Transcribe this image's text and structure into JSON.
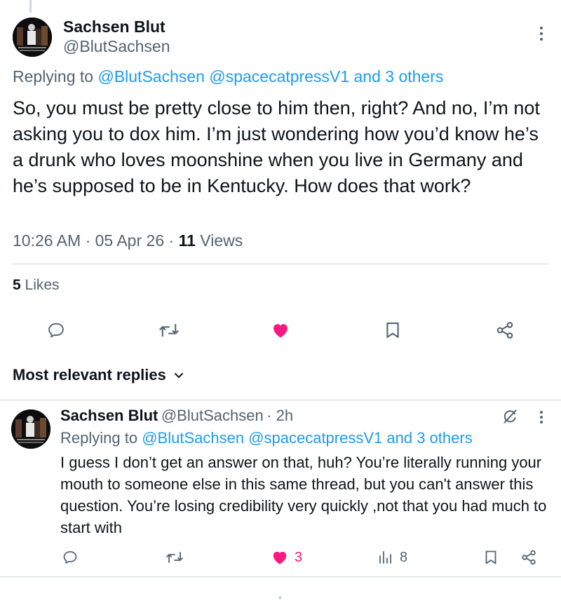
{
  "main_tweet": {
    "author_name": "Sachsen Blut",
    "author_handle": "@BlutSachsen",
    "replying_prefix": "Replying to",
    "replying_mentions": "@BlutSachsen @spacecatpressV1 and 3 others",
    "text": "So, you must be pretty close to him then, right? And no, I’m not asking you to dox him. I’m just wondering how you’d know he’s a drunk who loves moonshine when you live in Germany and he’s supposed to be in Kentucky. How does that work?",
    "time": "10:26 AM",
    "date": "05 Apr 26",
    "views_count": "11",
    "views_label": "Views",
    "likes_count": "5",
    "likes_label": "Likes",
    "liked": true
  },
  "replies_section": {
    "title": "Most relevant replies"
  },
  "reply": {
    "author_name": "Sachsen Blut",
    "author_handle": "@BlutSachsen",
    "age": "· 2h",
    "replying_prefix": "Replying to",
    "replying_mentions": "@BlutSachsen @spacecatpressV1 and 3 others",
    "text": "I guess I don’t get an answer on that, huh? You’re literally running your mouth to someone else in this same thread, but you can't answer this question. You’re losing credibility very quickly ,not that you had much to start with",
    "like_count": "3",
    "view_count": "8"
  },
  "icons": {
    "reply": "reply-icon",
    "retweet": "retweet-icon",
    "like": "heart-icon",
    "bookmark": "bookmark-icon",
    "share": "share-icon",
    "views": "views-icon",
    "more": "more-icon",
    "grok": "grok-icon",
    "chevron": "chevron-down-icon"
  },
  "colors": {
    "link": "#1d9bf0",
    "like": "#f91880",
    "secondary": "#536471",
    "text": "#0f1419",
    "divider": "#cfd9de"
  }
}
